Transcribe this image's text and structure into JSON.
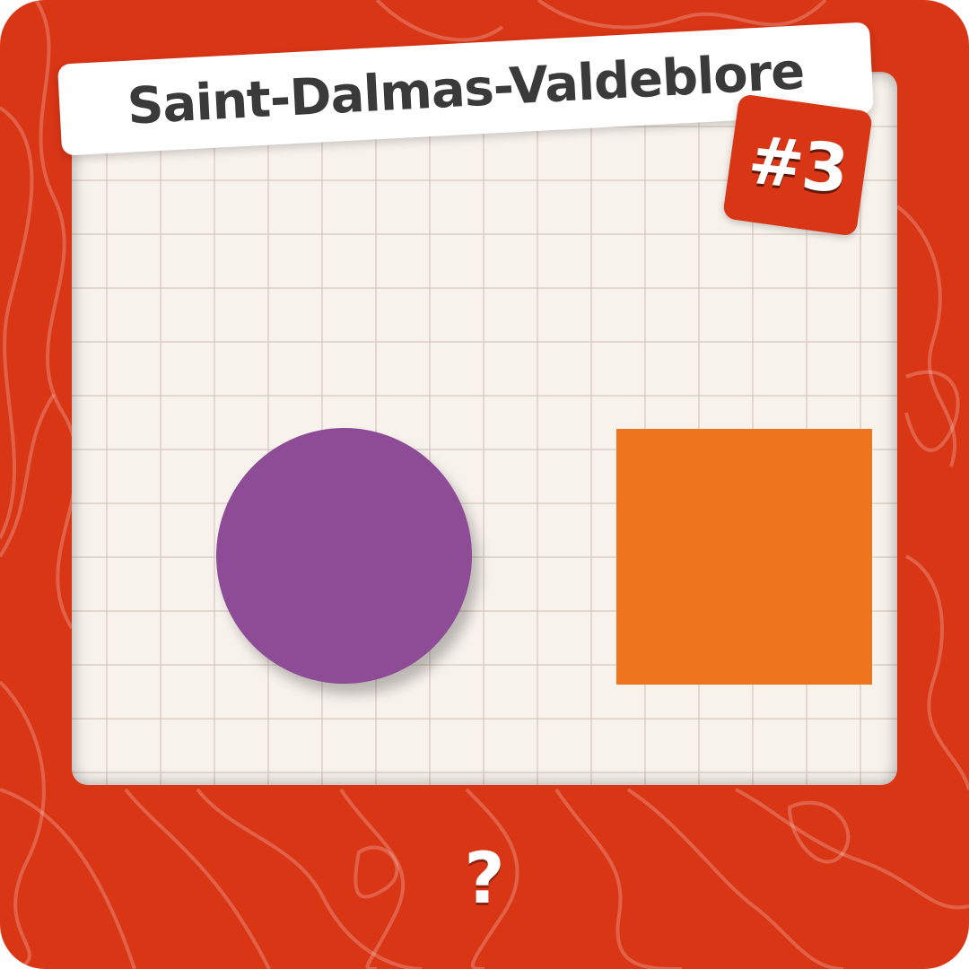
{
  "title": "Saint-Dalmas-Valdeblore",
  "badge": "#3",
  "answer_prompt": "?",
  "shapes": [
    {
      "kind": "circle",
      "color": "#8e4b96"
    },
    {
      "kind": "square",
      "color": "#ee741d"
    }
  ],
  "colors": {
    "background": "#d93616",
    "board": "#f8f2ed",
    "title_text": "#3a3a3a",
    "badge_bg": "#d93616"
  }
}
